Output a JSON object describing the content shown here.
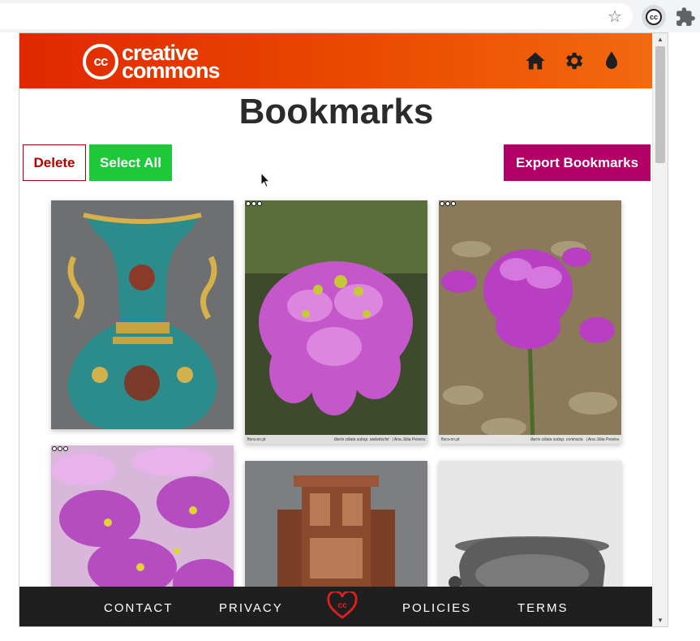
{
  "browser": {
    "star_icon": "star-icon",
    "cc_extension_label": "cc",
    "extensions_icon": "puzzle-icon"
  },
  "header": {
    "logo_mark": "cc",
    "logo_line1": "creative",
    "logo_line2": "commons",
    "icons": [
      "home-icon",
      "gear-icon",
      "drop-icon"
    ],
    "gradient": [
      "#e02800",
      "#f26a10"
    ]
  },
  "page": {
    "title": "Bookmarks"
  },
  "actions": {
    "delete_label": "Delete",
    "select_all_label": "Select All",
    "export_label": "Export Bookmarks"
  },
  "bookmarks": [
    {
      "subject": "cloisonne enamel vase",
      "caption": null
    },
    {
      "subject": "pink flower cluster",
      "caption": {
        "site": "flora-on.pt",
        "species": "Iberis ciliata subsp. welwitschii",
        "author": "| Ana Júlia Pereira"
      }
    },
    {
      "subject": "purple flower on rocks",
      "caption": {
        "site": "flora-on.pt",
        "species": "Iberis ciliata subsp. contracta",
        "author": "| Ana Júlia Pereira"
      }
    },
    {
      "subject": "magenta flowers close-up",
      "caption": null
    },
    {
      "subject": "carved wooden throne",
      "caption": null
    },
    {
      "subject": "silver metal vessel",
      "caption": null
    }
  ],
  "footer": {
    "contact": "CONTACT",
    "privacy": "PRIVACY",
    "policies": "POLICIES",
    "terms": "TERMS",
    "logo_mark": "cc"
  },
  "colors": {
    "delete": "#b30000",
    "select_all": "#1ec839",
    "export": "#b30066",
    "footer": "#1f1f1f",
    "footer_logo": "#e02020"
  }
}
